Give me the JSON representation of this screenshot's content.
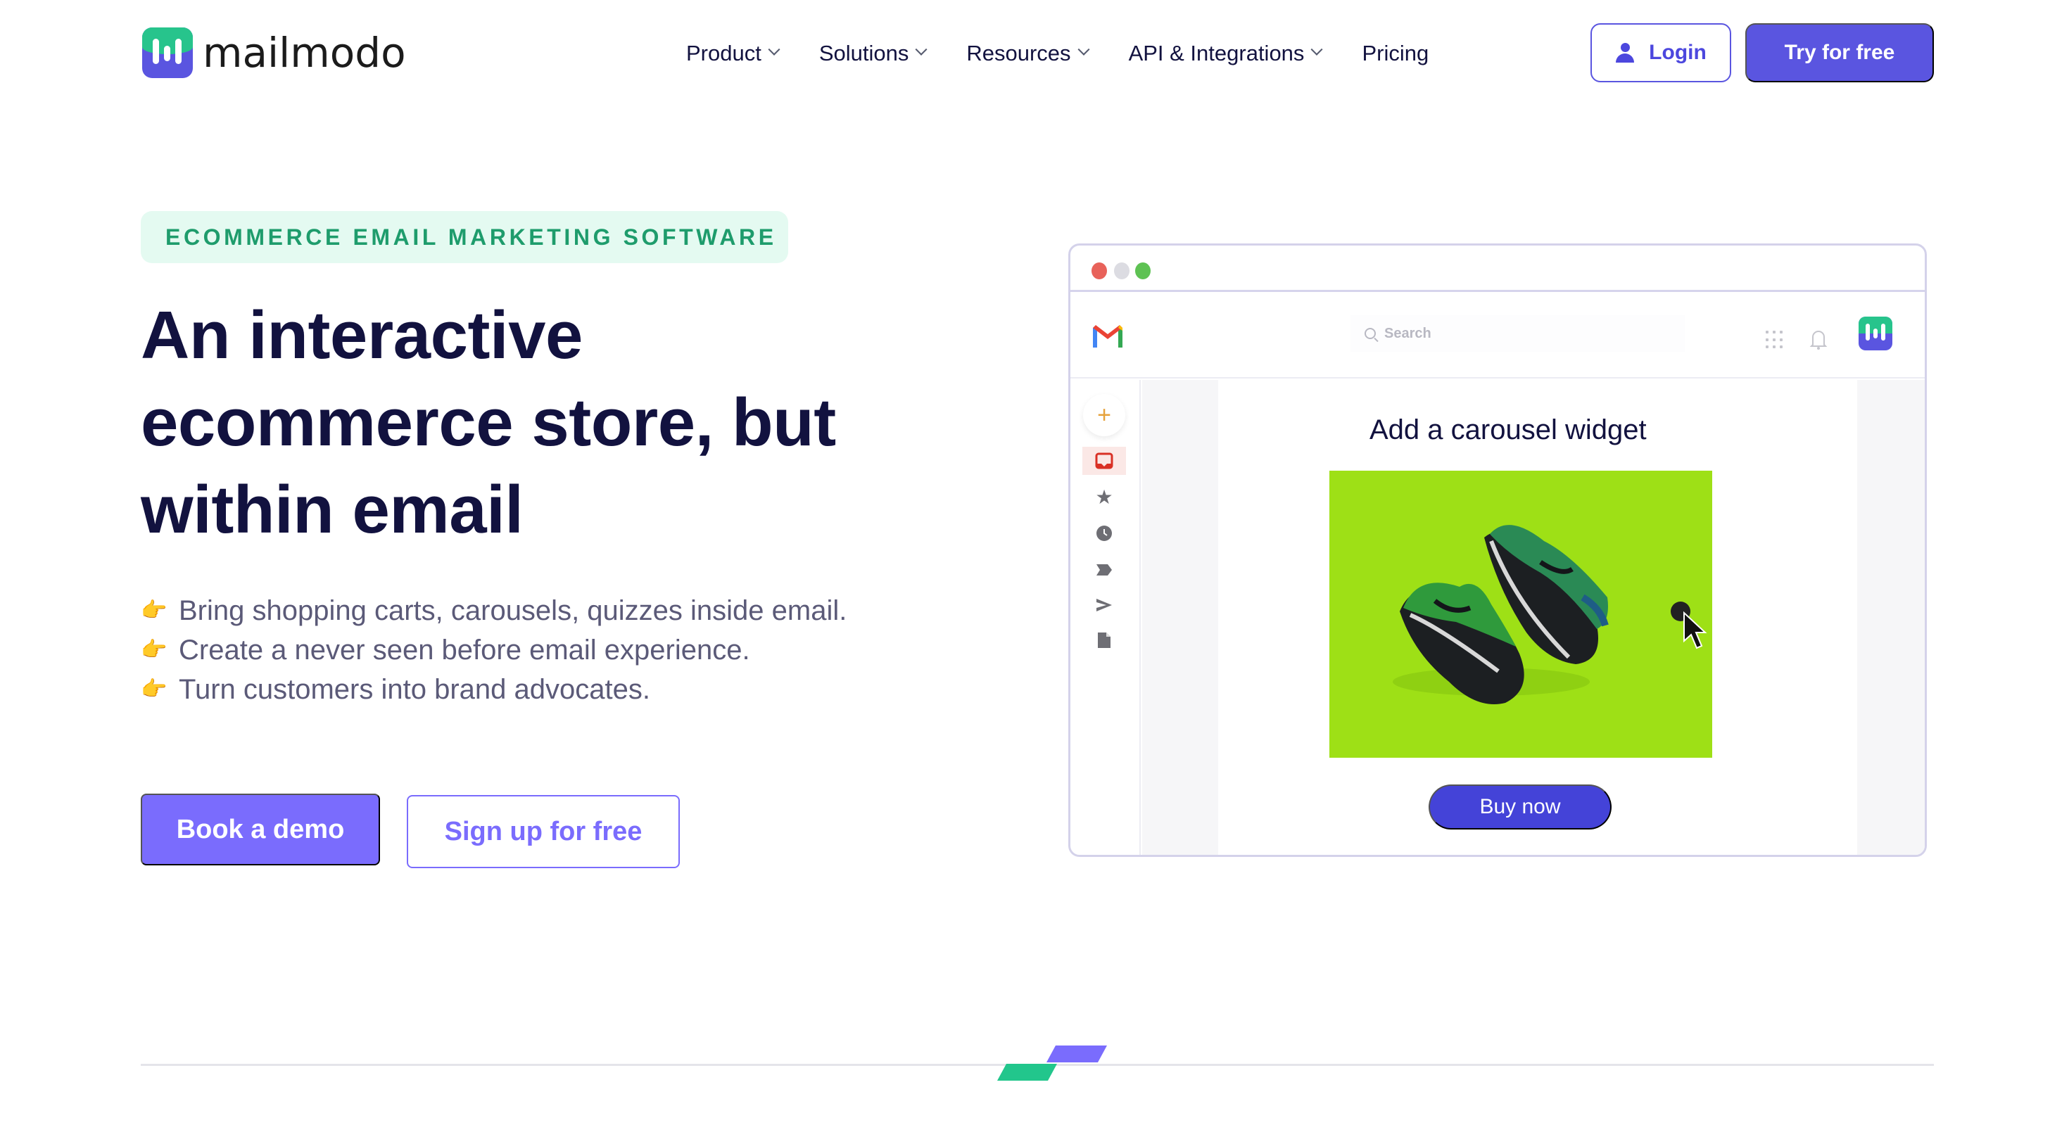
{
  "header": {
    "logo_text": "mailmodo",
    "nav": [
      {
        "label": "Product",
        "has_dropdown": true
      },
      {
        "label": "Solutions",
        "has_dropdown": true
      },
      {
        "label": "Resources",
        "has_dropdown": true
      },
      {
        "label": "API & Integrations",
        "has_dropdown": true
      },
      {
        "label": "Pricing",
        "has_dropdown": false
      }
    ],
    "login_label": "Login",
    "try_label": "Try for free"
  },
  "hero": {
    "eyebrow": "ECOMMERCE EMAIL MARKETING SOFTWARE",
    "headline": "An interactive ecommerce store, but within email",
    "bullets": [
      {
        "icon": "pointing-hand",
        "text": "Bring shopping carts, carousels, quizzes inside email."
      },
      {
        "icon": "pointing-hand",
        "text": "Create a never seen before email experience."
      },
      {
        "icon": "pointing-hand",
        "text": "Turn customers into brand advocates."
      }
    ],
    "primary_cta": "Book a demo",
    "secondary_cta": "Sign up for free"
  },
  "mockup": {
    "search_placeholder": "Search",
    "sidebar_icons": [
      "inbox",
      "star",
      "clock",
      "label",
      "send",
      "file"
    ],
    "card_title": "Add a carousel widget",
    "buy_label": "Buy now"
  },
  "colors": {
    "brand_primary": "#5a55e0",
    "cta_primary": "#7a6cfd",
    "brand_green": "#27c48c",
    "eyebrow_bg": "#e4faf1",
    "eyebrow_text": "#1e9c6c",
    "headline": "#12123f",
    "product_bg": "#9ee016",
    "buy_button": "#4443d8"
  }
}
